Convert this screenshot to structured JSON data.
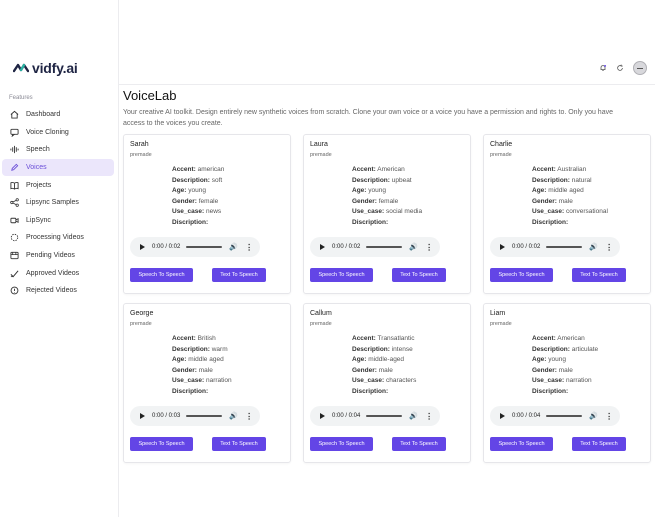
{
  "app": {
    "name": "vidfy.ai",
    "brand_color": "#6345e6"
  },
  "sidebar": {
    "section_label": "Features",
    "items": [
      {
        "label": "Dashboard",
        "icon": "home-icon",
        "active": false
      },
      {
        "label": "Voice Cloning",
        "icon": "chat-icon",
        "active": false
      },
      {
        "label": "Speech",
        "icon": "waveform-icon",
        "active": false
      },
      {
        "label": "Voices",
        "icon": "pen-icon",
        "active": true
      },
      {
        "label": "Projects",
        "icon": "book-icon",
        "active": false
      },
      {
        "label": "Lipsync Samples",
        "icon": "nodes-icon",
        "active": false
      },
      {
        "label": "LipSync",
        "icon": "video-icon",
        "active": false
      },
      {
        "label": "Processing Videos",
        "icon": "spinner-icon",
        "active": false
      },
      {
        "label": "Pending Videos",
        "icon": "film-icon",
        "active": false
      },
      {
        "label": "Approved Videos",
        "icon": "check-icon",
        "active": false
      },
      {
        "label": "Rejected Videos",
        "icon": "alert-icon",
        "active": false
      }
    ]
  },
  "header": {
    "icons": [
      "bell-icon",
      "refresh-icon",
      "avatar-icon"
    ]
  },
  "main": {
    "title": "VoiceLab",
    "description": "Your creative AI toolkit. Design entirely new synthetic voices from scratch. Clone your own voice or a voice you have a permission and rights to. Only you have access to the voices you create."
  },
  "labels": {
    "accent": "Accent:",
    "description": "Description:",
    "age": "Age:",
    "gender": "Gender:",
    "use_case": "Use_case:",
    "discription": "Discription:",
    "speech_to_speech": "Speech To Speech",
    "text_to_speech": "Text To Speech"
  },
  "voices": [
    {
      "name": "Sarah",
      "category": "premade",
      "accent": "american",
      "description": "soft",
      "age": "young",
      "gender": "female",
      "use_case": "news",
      "discription": "",
      "audio_time": "0:00 / 0:02"
    },
    {
      "name": "Laura",
      "category": "premade",
      "accent": "American",
      "description": "upbeat",
      "age": "young",
      "gender": "female",
      "use_case": "social media",
      "discription": "",
      "audio_time": "0:00 / 0:02"
    },
    {
      "name": "Charlie",
      "category": "premade",
      "accent": "Australian",
      "description": "natural",
      "age": "middle aged",
      "gender": "male",
      "use_case": "conversational",
      "discription": "",
      "audio_time": "0:00 / 0:02"
    },
    {
      "name": "George",
      "category": "premade",
      "accent": "British",
      "description": "warm",
      "age": "middle aged",
      "gender": "male",
      "use_case": "narration",
      "discription": "",
      "audio_time": "0:00 / 0:03"
    },
    {
      "name": "Callum",
      "category": "premade",
      "accent": "Transatlantic",
      "description": "intense",
      "age": "middle-aged",
      "gender": "male",
      "use_case": "characters",
      "discription": "",
      "audio_time": "0:00 / 0:04"
    },
    {
      "name": "Liam",
      "category": "premade",
      "accent": "American",
      "description": "articulate",
      "age": "young",
      "gender": "male",
      "use_case": "narration",
      "discription": "",
      "audio_time": "0:00 / 0:04"
    }
  ]
}
